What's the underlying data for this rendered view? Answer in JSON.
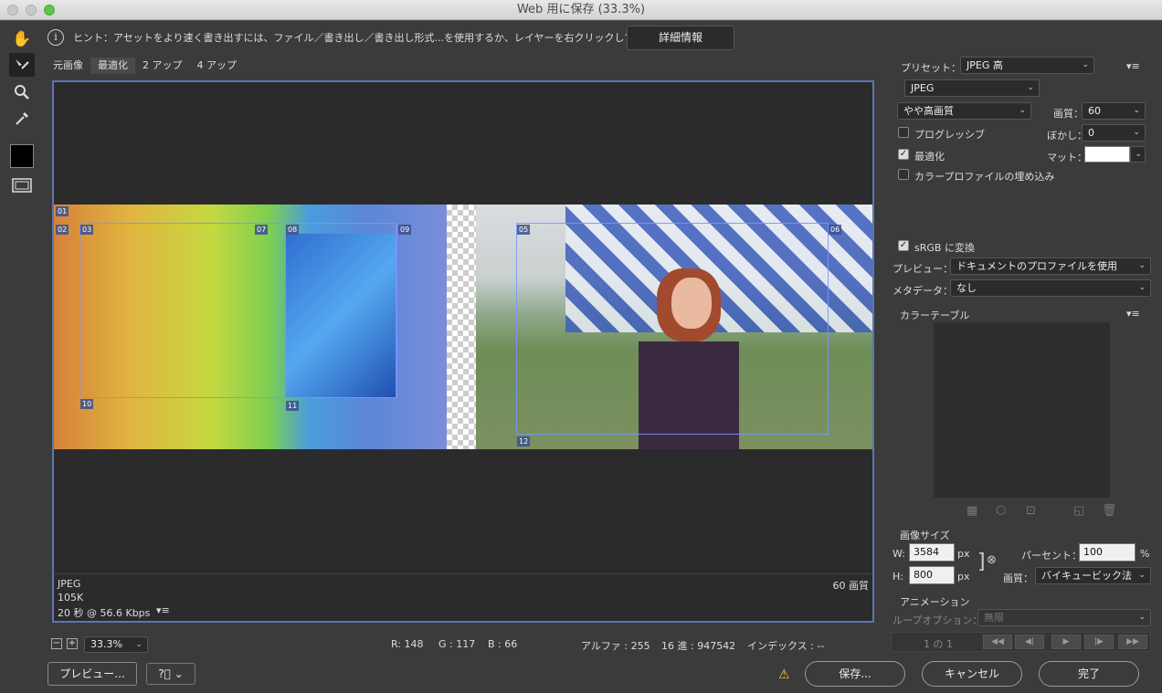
{
  "window": {
    "title": "Web 用に保存 (33.3%)"
  },
  "hint": {
    "text": "ヒント：アセットをより速く書き出すには、ファイル／書き出し／書き出し形式...を使用するか、レイヤーを右クリックして使用。",
    "details_button": "詳細情報"
  },
  "tabs": [
    "元画像",
    "最適化",
    "2 アップ",
    "4 アップ"
  ],
  "slices": [
    "01",
    "02",
    "03",
    "05",
    "06",
    "07",
    "08",
    "09",
    "10",
    "11",
    "12"
  ],
  "canvas_status": {
    "format": "JPEG",
    "size": "105K",
    "time": "20 秒 @ 56.6 Kbps",
    "quality": "60 画質"
  },
  "bottom_bar": {
    "zoom": "33.3%",
    "r": "R: 148",
    "g": "G : 117",
    "b": "B : 66",
    "alpha": "アルファ : 255",
    "hex": "16 進 : 947542",
    "index": "インデックス : --"
  },
  "settings": {
    "preset_label": "プリセット：",
    "preset_value": "JPEG 高",
    "format": "JPEG",
    "quality_preset": "やや高画質",
    "quality_label": "画質：",
    "quality_value": "60",
    "progressive_label": "プログレッシブ",
    "blur_label": "ぼかし：",
    "blur_value": "0",
    "optimized_label": "最適化",
    "matte_label": "マット：",
    "embed_profile_label": "カラープロファイルの埋め込み",
    "srgb_label": "sRGB に変換",
    "preview_label": "プレビュー：",
    "preview_value": "ドキュメントのプロファイルを使用",
    "metadata_label": "メタデータ：",
    "metadata_value": "なし",
    "color_table_label": "カラーテーブル"
  },
  "image_size": {
    "label": "画像サイズ",
    "w_label": "W:",
    "w_value": "3584",
    "w_unit": "px",
    "h_label": "H:",
    "h_value": "800",
    "h_unit": "px",
    "percent_label": "パーセント：",
    "percent_value": "100",
    "percent_unit": "%",
    "quality_label": "画質：",
    "quality_value": "バイキュービック法"
  },
  "animation": {
    "label": "アニメーション",
    "loop_label": "ループオプション：",
    "loop_value": "無限",
    "frame": "1 の 1"
  },
  "footer": {
    "preview_button": "プレビュー...",
    "save_button": "保存...",
    "cancel_button": "キャンセル",
    "done_button": "完了"
  },
  "colors": {
    "accent": "#5a76b0",
    "panel": "#3b3b3b",
    "canvas_bg": "#2b2b2b"
  }
}
